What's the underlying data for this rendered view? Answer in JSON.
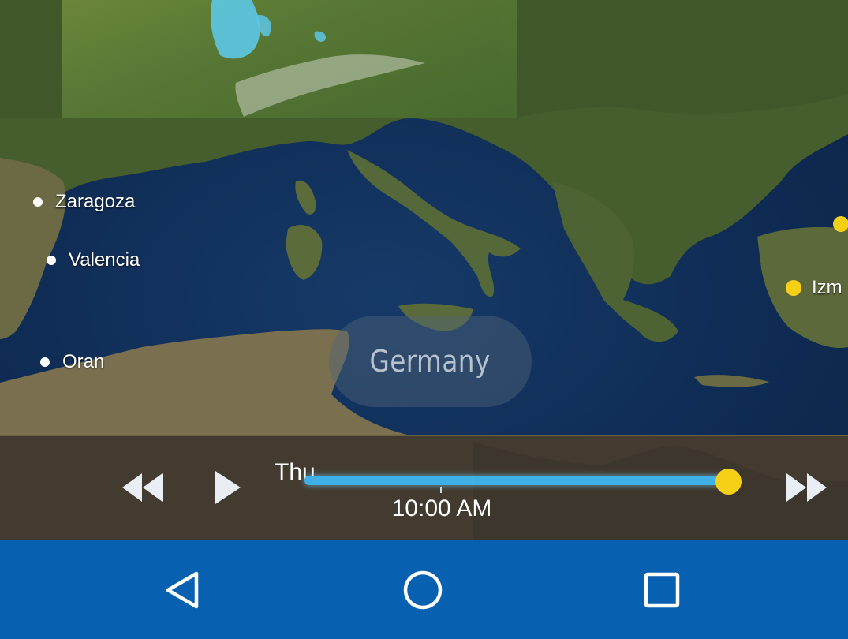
{
  "map": {
    "country_label": "Germany",
    "cities": [
      {
        "name": "Zaragoza",
        "dot_color": "#ffffff"
      },
      {
        "name": "Valencia",
        "dot_color": "#ffffff"
      },
      {
        "name": "Oran",
        "dot_color": "#ffffff"
      },
      {
        "name": "Izm",
        "dot_color": "#f6cf17"
      },
      {
        "name": "",
        "dot_color": "#f6cf17"
      }
    ]
  },
  "player": {
    "day": "Thu",
    "time": "10:00 AM",
    "progress": 1.0,
    "rewind_icon": "rewind-icon",
    "play_icon": "play-icon",
    "fast_forward_icon": "fast-forward-icon",
    "accent_color": "#3fb0e6",
    "thumb_color": "#f6cf17"
  },
  "navbar": {
    "back_icon": "back-triangle-icon",
    "home_icon": "home-circle-icon",
    "recents_icon": "recents-square-icon",
    "color": "#0761b0"
  }
}
